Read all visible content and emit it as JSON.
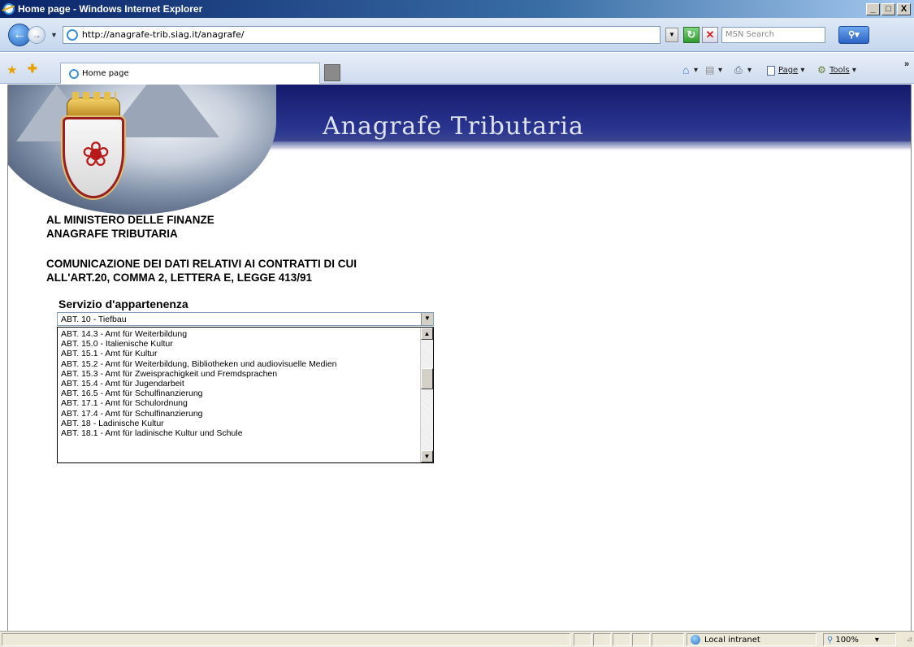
{
  "window": {
    "title": "Home page - Windows Internet Explorer",
    "minimize": "_",
    "maximize": "□",
    "close": "X"
  },
  "address": {
    "url": "http://anagrafe-trib.siag.it/anagrafe/",
    "search_placeholder": "MSN Search"
  },
  "tabs": [
    {
      "label": "Home page"
    }
  ],
  "commands": {
    "page": "Page",
    "tools": "Tools"
  },
  "page": {
    "banner_title": "Anagrafe Tributaria",
    "heading_line1": "AL MINISTERO DELLE FINANZE",
    "heading_line2": "ANAGRAFE TRIBUTARIA",
    "subheading_line1": "COMUNICAZIONE DEI DATI RELATIVI AI CONTRATTI DI CUI",
    "subheading_line2": "ALL'ART.20, COMMA 2, LETTERA E, LEGGE 413/91",
    "field_label": "Servizio d'appartenenza",
    "selected_value": "ABT. 10 - Tiefbau",
    "options": [
      "ABT. 14.3 - Amt für Weiterbildung",
      "ABT. 15.0 - Italienische Kultur",
      "ABT. 15.1 - Amt für Kultur",
      "ABT. 15.2 - Amt für Weiterbildung, Bibliotheken und audiovisuelle Medien",
      "ABT. 15.3 - Amt für Zweisprachigkeit und Fremdsprachen",
      "ABT. 15.4 - Amt für Jugendarbeit",
      "ABT. 16.5 - Amt für Schulfinanzierung",
      "ABT. 17.1 - Amt für Schulordnung",
      "ABT. 17.4 - Amt für Schulfinanzierung",
      "ABT. 18 - Ladinische Kultur",
      "ABT. 18.1 - Amt für ladinische Kultur und Schule"
    ]
  },
  "status": {
    "zone": "Local intranet",
    "zoom": "100%"
  },
  "colors": {
    "banner": "#1b2478",
    "titlebar": "#0a246a"
  }
}
